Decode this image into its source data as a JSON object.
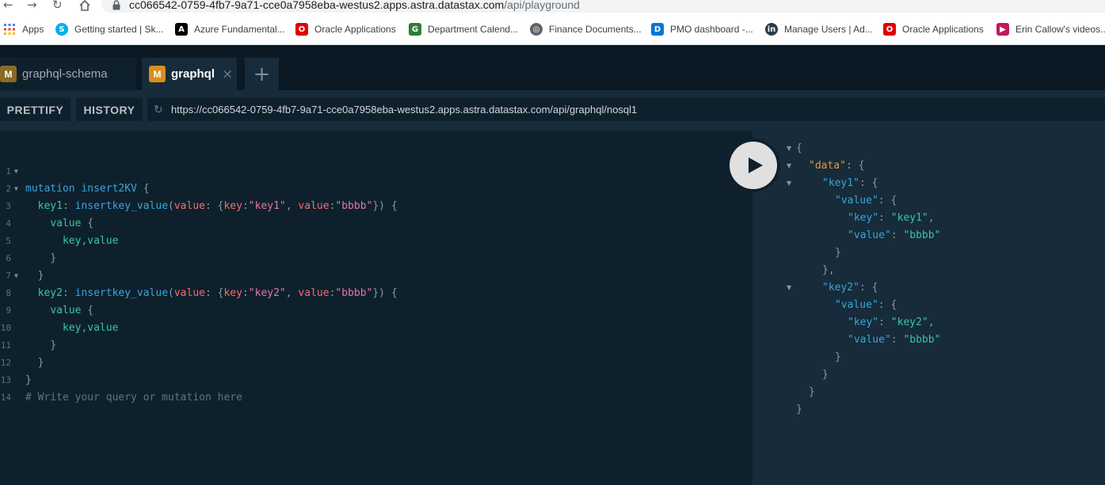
{
  "browser": {
    "url_host": "cc066542-0759-4fb7-9a71-cce0a7958eba-westus2.apps.astra.datastax.com",
    "url_path": "/api/playground",
    "bookmarks": [
      {
        "label": "Apps",
        "icon": "apps-grid-icon",
        "color": "#4285f4"
      },
      {
        "label": "Getting started | Sk...",
        "icon": "skype-icon",
        "color": "#00aff0"
      },
      {
        "label": "Azure Fundamental...",
        "icon": "azure-a-icon",
        "color": "#000000"
      },
      {
        "label": "Oracle Applications",
        "icon": "oracle-icon",
        "color": "#e00000"
      },
      {
        "label": "Department Calend...",
        "icon": "department-icon",
        "color": "#2e7d32"
      },
      {
        "label": "Finance Documents...",
        "icon": "globe-icon",
        "color": "#5f6368"
      },
      {
        "label": "PMO dashboard -...",
        "icon": "devops-icon",
        "color": "#0078d4"
      },
      {
        "label": "Manage Users | Ad...",
        "icon": "linkedin-icon",
        "color": "#283e4a"
      },
      {
        "label": "Oracle Applications",
        "icon": "oracle-icon",
        "color": "#e00000"
      },
      {
        "label": "Erin Callow's videos...",
        "icon": "video-play-icon",
        "color": "#c2185b"
      }
    ]
  },
  "tabs": [
    {
      "badge": "M",
      "label": "graphql-schema"
    },
    {
      "badge": "M",
      "label": "graphql",
      "close": "×"
    }
  ],
  "add_tab": "+",
  "toolbar": {
    "prettify": "PRETTIFY",
    "history": "HISTORY",
    "endpoint": "https://cc066542-0759-4fb7-9a71-cce0a7958eba-westus2.apps.astra.datastax.com/api/graphql/nosql1"
  },
  "editor": {
    "line_numbers": [
      "1",
      "2",
      "3",
      "4",
      "5",
      "6",
      "7",
      "8",
      "9",
      "10",
      "11",
      "12",
      "13",
      "14"
    ],
    "code": {
      "l1_kw": "mutation",
      "l1_name": "insert2KV",
      "l2_alias": "key1",
      "l2_fn": "insertkey_value",
      "arg_value": "value",
      "arg_key": "key",
      "l2_key": "\"key1\"",
      "l2_val": "\"bbbb\"",
      "l3_field": "value",
      "l4_fields": "key,value",
      "l7_alias": "key2",
      "l7_key": "\"key2\"",
      "l7_val": "\"bbbb\"",
      "l13_comment": "# Write your query or mutation here"
    }
  },
  "result": {
    "data_key": "\"data\"",
    "key1": "\"key1\"",
    "key2": "\"key2\"",
    "value_key": "\"value\"",
    "key_key": "\"key\"",
    "key1_key_val": "\"key1\",",
    "key1_value_val": "\"bbbb\"",
    "key2_key_val": "\"key2\",",
    "key2_value_val": "\"bbbb\""
  }
}
